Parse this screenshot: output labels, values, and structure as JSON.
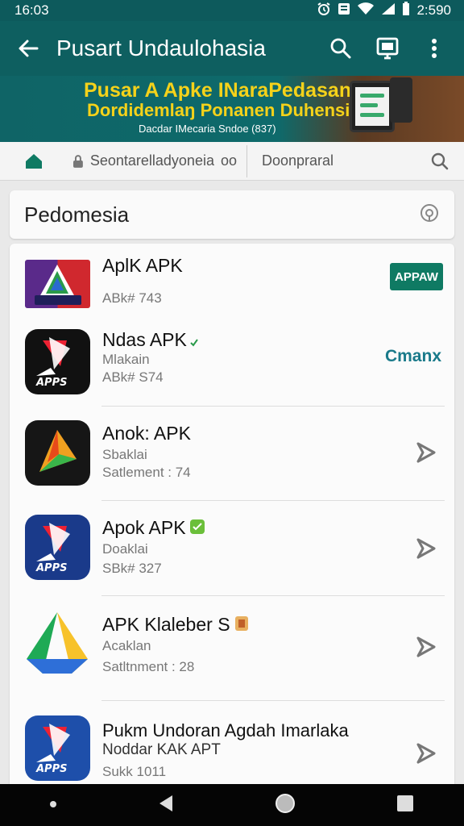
{
  "status_bar": {
    "time": "16:03",
    "clock_right": "2:590"
  },
  "app_bar": {
    "title": "Pusart Undaulohasia"
  },
  "banner": {
    "headline": "Pusar A Apke INaraPedasan",
    "subheadline": "Dordidemlaŋ Ponanen Duhensian",
    "caption": "Dacdar IMecaria Sndoe (837)"
  },
  "search_bar": {
    "field_text": "Seontarelladyoneia",
    "field_suffix": "oo",
    "filter_text": "Doonpraral"
  },
  "section": {
    "title": "Pedomesia"
  },
  "apps": [
    {
      "name": "AplK APK",
      "line1": "ABk# 743",
      "line2": "",
      "action": "install",
      "action_label": "APPAW"
    },
    {
      "name": "Ndas APK",
      "line1": "Mlakain",
      "line2": "ABk# S74",
      "action": "open",
      "action_label": "Cmanx"
    },
    {
      "name": "Anok: APK",
      "line1": "Sbaklai",
      "line2": "Satlement : 74",
      "action": "share",
      "action_label": ""
    },
    {
      "name": "Apok APK",
      "line1": "Doaklai",
      "line2": "SBk# 327",
      "action": "share",
      "action_label": ""
    },
    {
      "name": "APK Klaleber S",
      "line1": "Acaklan",
      "line2": "Satltnment : 28",
      "action": "share",
      "action_label": ""
    },
    {
      "name": "Pukm Undoran Agdah Imarlaka",
      "line1": "Noddar KAK APT",
      "line2": "Sukk 1011",
      "action": "share",
      "action_label": ""
    }
  ],
  "colors": {
    "app_bar": "#0e5f60",
    "banner_text": "#f5d21a",
    "install": "#0f7a63",
    "open_link": "#1a7a8a"
  }
}
